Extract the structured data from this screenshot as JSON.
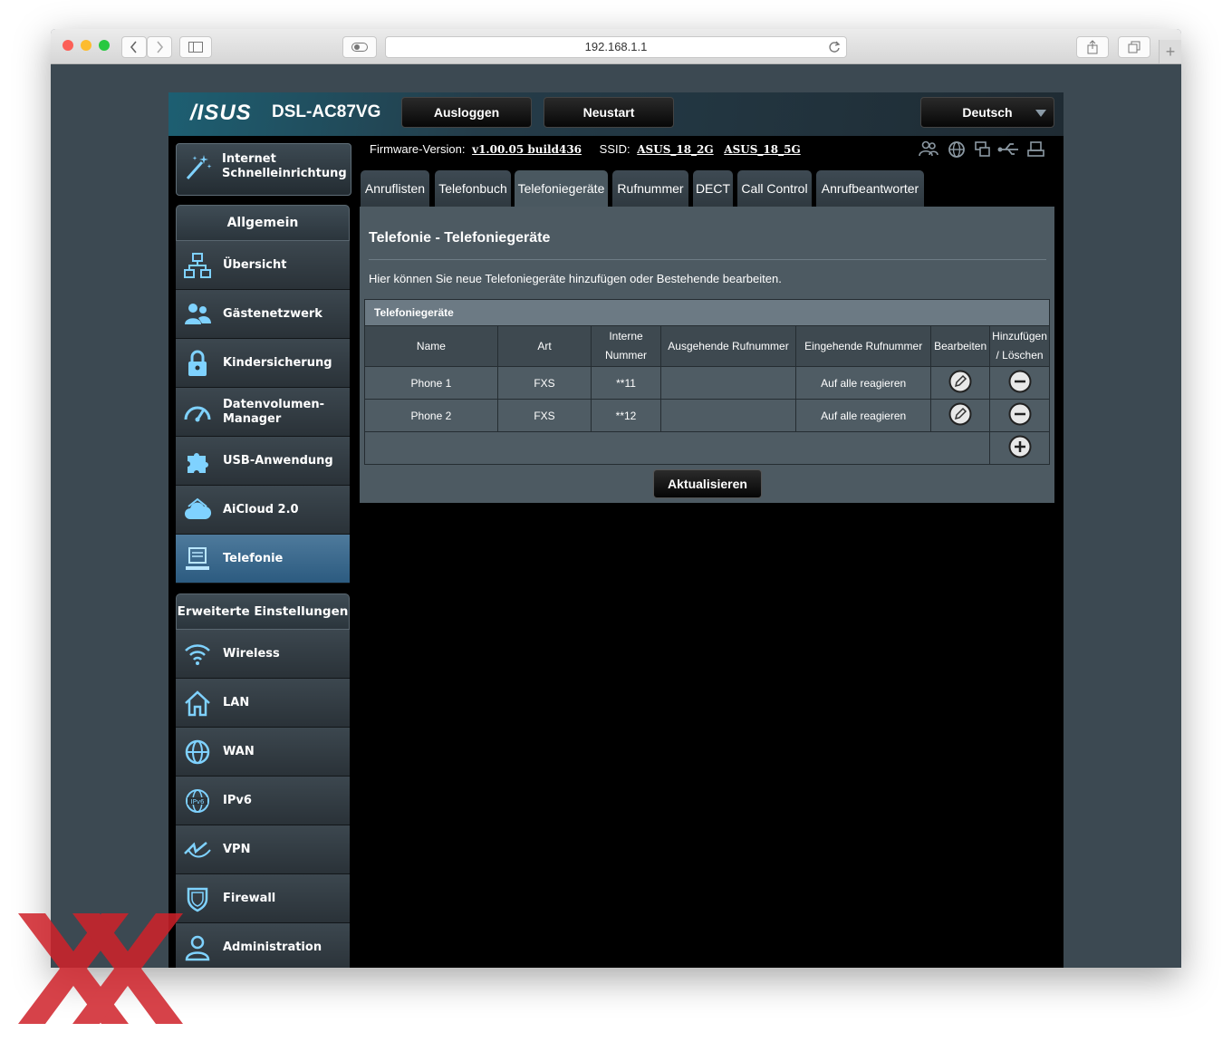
{
  "browser": {
    "url": "192.168.1.1",
    "traffic_lights": {
      "close": "#fc5f57",
      "minimize": "#fdbc2e",
      "zoom": "#28c840"
    }
  },
  "header": {
    "brand": "/ISUS",
    "model": "DSL-AC87VG",
    "logout_label": "Ausloggen",
    "restart_label": "Neustart",
    "language": "Deutsch"
  },
  "infobar": {
    "firmware_label": "Firmware-Version:",
    "firmware_value": "v1.00.05 build436",
    "ssid_label": "SSID:",
    "ssid_2g": "ASUS_18_2G",
    "ssid_5g": "ASUS_18_5G",
    "status_icons": [
      "clients-icon",
      "internet-globe-icon",
      "devices-icon",
      "usb-icon",
      "printer-icon"
    ]
  },
  "sidebar": {
    "quick_setup": "Internet Schnelleinrichtung",
    "general_title": "Allgemein",
    "general_items": [
      {
        "label": "Übersicht",
        "icon": "network-map-icon"
      },
      {
        "label": "Gästenetzwerk",
        "icon": "guest-network-icon"
      },
      {
        "label": "Kindersicherung",
        "icon": "parental-lock-icon"
      },
      {
        "label": "Datenvolumen-Manager",
        "icon": "speedometer-icon"
      },
      {
        "label": "USB-Anwendung",
        "icon": "puzzle-icon"
      },
      {
        "label": "AiCloud 2.0",
        "icon": "cloud-icon"
      },
      {
        "label": "Telefonie",
        "icon": "telephony-icon",
        "active": true
      }
    ],
    "advanced_title": "Erweiterte Einstellungen",
    "advanced_items": [
      {
        "label": "Wireless",
        "icon": "wifi-icon"
      },
      {
        "label": "LAN",
        "icon": "home-icon"
      },
      {
        "label": "WAN",
        "icon": "globe-icon"
      },
      {
        "label": "IPv6",
        "icon": "ipv6-globe-icon"
      },
      {
        "label": "VPN",
        "icon": "vpn-icon"
      },
      {
        "label": "Firewall",
        "icon": "shield-icon"
      },
      {
        "label": "Administration",
        "icon": "admin-user-icon"
      }
    ]
  },
  "tabs": [
    {
      "label": "Anruflisten"
    },
    {
      "label": "Telefonbuch"
    },
    {
      "label": "Telefoniegeräte",
      "active": true
    },
    {
      "label": "Rufnummer"
    },
    {
      "label": "DECT"
    },
    {
      "label": "Call Control"
    },
    {
      "label": "Anrufbeantworter"
    }
  ],
  "main": {
    "title": "Telefonie - Telefoniegeräte",
    "description": "Hier können Sie neue Telefoniegeräte hinzufügen oder Bestehende bearbeiten.",
    "table_title": "Telefoniegeräte",
    "columns": [
      "Name",
      "Art",
      "Interne Nummer",
      "Ausgehende Rufnummer",
      "Eingehende Rufnummer",
      "Bearbeiten",
      "Hinzufügen / Löschen"
    ],
    "rows": [
      {
        "name": "Phone 1",
        "type": "FXS",
        "internal": "**11",
        "outgoing": "",
        "incoming": "Auf alle reagieren"
      },
      {
        "name": "Phone 2",
        "type": "FXS",
        "internal": "**12",
        "outgoing": "",
        "incoming": "Auf alle reagieren"
      }
    ],
    "refresh_label": "Aktualisieren"
  },
  "accent_colors": {
    "active_item": "#3d6d92",
    "content_panel": "#4d5a62",
    "watermark": "#d0222a"
  }
}
